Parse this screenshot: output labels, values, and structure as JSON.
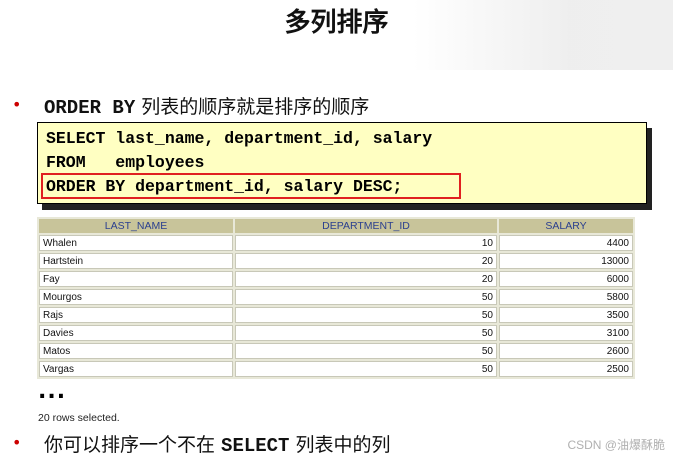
{
  "slide": {
    "title": "多列排序"
  },
  "bullet1": {
    "marker": "•",
    "keyword": "ORDER BY",
    "text": " 列表的顺序就是排序的顺序"
  },
  "code": {
    "line1": "SELECT last_name, department_id, salary",
    "line2": "FROM   employees",
    "line3": "ORDER BY department_id, salary DESC;"
  },
  "table": {
    "headers": [
      "LAST_NAME",
      "DEPARTMENT_ID",
      "SALARY"
    ],
    "rows": [
      [
        "Whalen",
        "10",
        "4400"
      ],
      [
        "Hartstein",
        "20",
        "13000"
      ],
      [
        "Fay",
        "20",
        "6000"
      ],
      [
        "Mourgos",
        "50",
        "5800"
      ],
      [
        "Rajs",
        "50",
        "3500"
      ],
      [
        "Davies",
        "50",
        "3100"
      ],
      [
        "Matos",
        "50",
        "2600"
      ],
      [
        "Vargas",
        "50",
        "2500"
      ]
    ]
  },
  "footer": {
    "ellipsis": "...",
    "rows_selected": "20 rows selected."
  },
  "bullet2": {
    "marker": "•",
    "prefix": "你可以排序一个不在 ",
    "keyword": "SELECT",
    "suffix": " 列表中的列"
  },
  "watermark": "CSDN @油爆酥脆",
  "colors": {
    "bullet": "#cc0000",
    "code_bg": "#ffffc2",
    "highlight_border": "#e02020",
    "table_header_bg": "#c8c49a",
    "table_header_text": "#2a3f8f"
  }
}
